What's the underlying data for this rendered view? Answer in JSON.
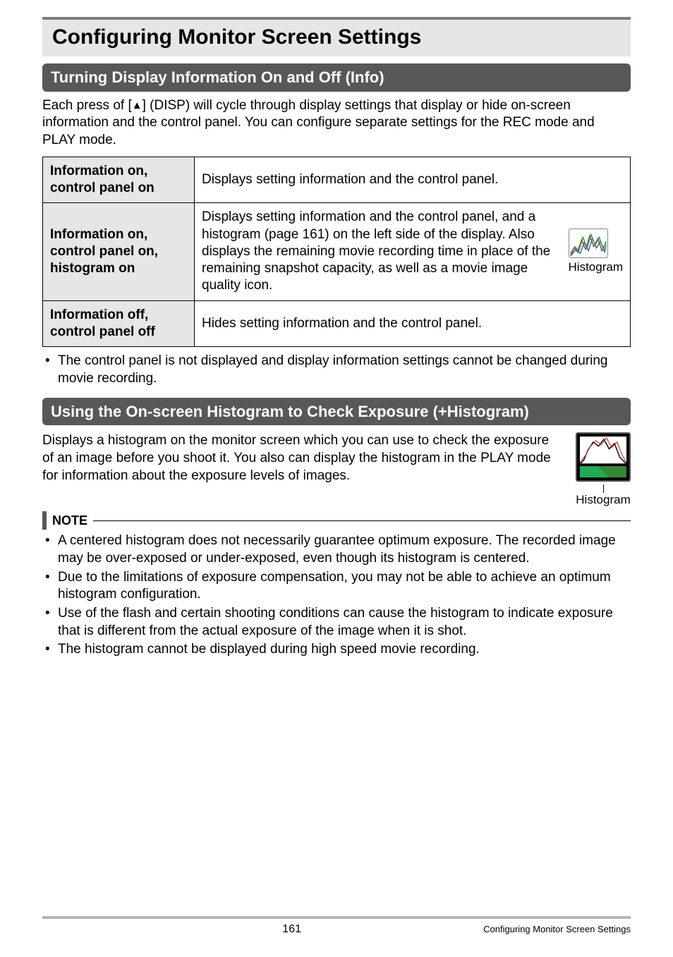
{
  "chapter_title": "Configuring Monitor Screen Settings",
  "section1": {
    "heading": "Turning Display Information On and Off (Info)",
    "intro_pre": "Each press of [",
    "intro_post": "] (DISP) will cycle through display settings that display or hide on-screen information and the control panel. You can configure separate settings for the REC mode and PLAY mode.",
    "table": {
      "row1": {
        "label": "Information on, control panel on",
        "desc": "Displays setting information and the control panel."
      },
      "row2": {
        "label": "Information on, control panel on, histogram on",
        "desc": "Displays setting information and the control panel, and a histogram (page 161) on the left side of the display. Also displays the remaining movie recording time in place of the remaining snapshot capacity, as well as a movie image quality icon.",
        "fig_caption": "Histogram"
      },
      "row3": {
        "label": "Information off, control panel off",
        "desc": "Hides setting information and the control panel."
      }
    },
    "note": "The control panel is not displayed and display information settings cannot be changed during movie recording."
  },
  "section2": {
    "heading": "Using the On-screen Histogram to Check Exposure (+Histogram)",
    "intro": "Displays a histogram on the monitor screen which you can use to check the exposure of an image before you shoot it. You also can display the histogram in the PLAY mode for information about the exposure levels of images.",
    "fig_caption": "Histogram",
    "note_label": "NOTE",
    "notes": [
      "A centered histogram does not necessarily guarantee optimum exposure. The recorded image may be over-exposed or under-exposed, even though its histogram is centered.",
      "Due to the limitations of exposure compensation, you may not be able to achieve an optimum histogram configuration.",
      "Use of the flash and certain shooting conditions can cause the histogram to indicate exposure that is different from the actual exposure of the image when it is shot.",
      "The histogram cannot be displayed during high speed movie recording."
    ]
  },
  "footer": {
    "page_number": "161",
    "running_title": "Configuring Monitor Screen Settings"
  }
}
